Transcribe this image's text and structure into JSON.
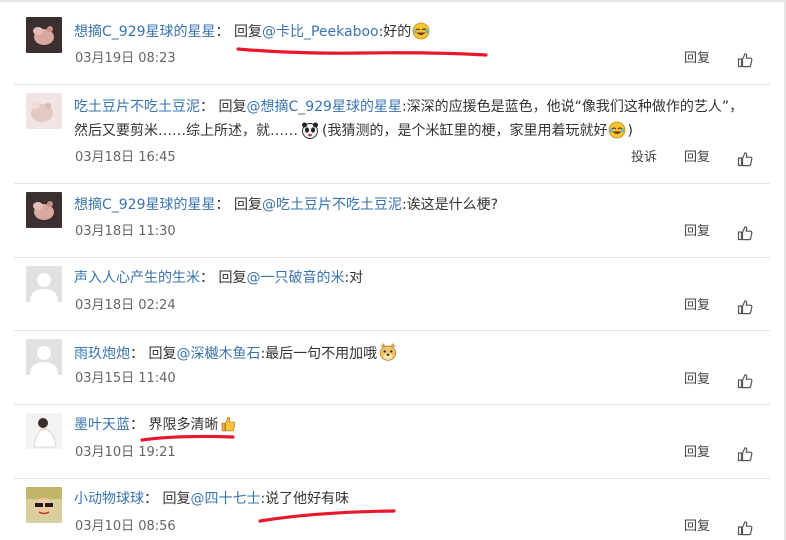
{
  "comments": [
    {
      "user": "想摘C_929星球的星星",
      "sep": "：",
      "reply_prefix": "回复",
      "mention": "@卡比_Peekaboo",
      "text": ":好的",
      "time": "03月19日 08:23",
      "actions": {
        "reply": "回复"
      }
    },
    {
      "user": "吃土豆片不吃土豆泥",
      "sep": "：",
      "reply_prefix": "回复",
      "mention": "@想摘C_929星球的星星",
      "text": ":深深的应援色是蓝色，他说“像我们这种做作的艺人”，",
      "text_line2": "然后又要剪米……综上所述，就……",
      "text_line2b": "(我猜测的，是个米缸里的梗，家里用着玩就好",
      "text_line2c": ")",
      "time": "03月18日 16:45",
      "actions": {
        "report": "投诉",
        "reply": "回复"
      }
    },
    {
      "user": "想摘C_929星球的星星",
      "sep": "：",
      "reply_prefix": "回复",
      "mention": "@吃土豆片不吃土豆泥",
      "text": ":诶这是什么梗?",
      "time": "03月18日 11:30",
      "actions": {
        "reply": "回复"
      }
    },
    {
      "user": "声入人心产生的生米",
      "sep": "：",
      "reply_prefix": "回复",
      "mention": "@一只破音的米",
      "text": ":对",
      "time": "03月18日 02:24",
      "actions": {
        "reply": "回复"
      }
    },
    {
      "user": "雨玖炮炮",
      "sep": "：",
      "reply_prefix": "回复",
      "mention": "@深樾木鱼石",
      "text": ":最后一句不用加哦",
      "time": "03月15日 11:40",
      "actions": {
        "reply": "回复"
      }
    },
    {
      "user": "墨叶天蓝",
      "sep": "：",
      "text": "界限多清晰",
      "time": "03月10日 19:21",
      "actions": {
        "reply": "回复"
      }
    },
    {
      "user": "小动物球球",
      "sep": "：",
      "reply_prefix": "回复",
      "mention": "@四十七士",
      "text": ":说了他好有味",
      "time": "03月10日 08:56",
      "actions": {
        "reply": "回复"
      }
    }
  ],
  "icons": {
    "like": "thumbs-up-icon",
    "laugh": "laugh-cry-emoji-icon",
    "panda": "panda-emoji-icon",
    "doge": "doge-emoji-icon",
    "good": "thumbs-up-emoji-icon"
  },
  "colors": {
    "link": "#3a74b0",
    "text": "#333333",
    "meta": "#666666",
    "annotation_red": "#e8182b",
    "separator": "#e4e4e4"
  }
}
